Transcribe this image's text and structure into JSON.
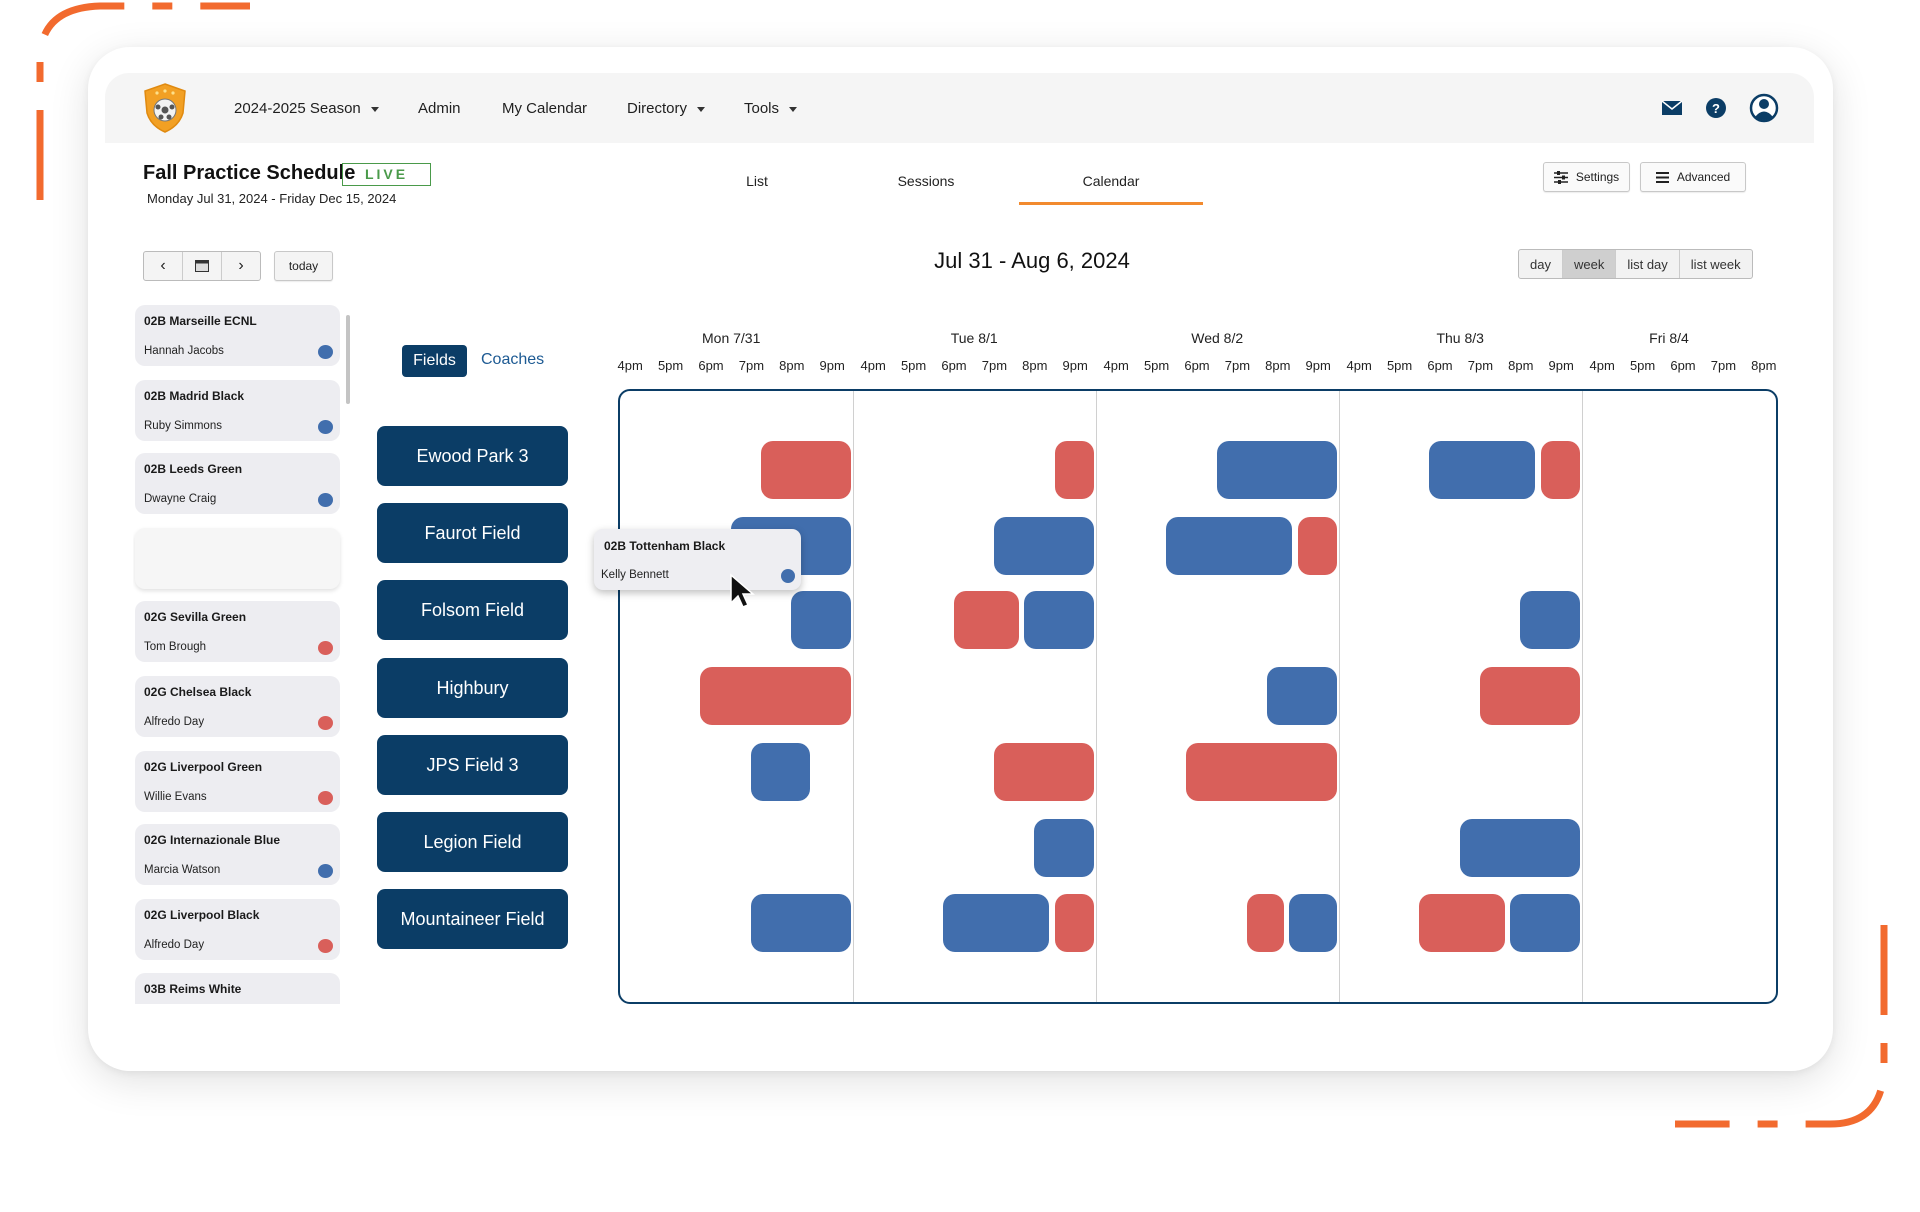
{
  "colors": {
    "navy": "#0b3d66",
    "blue": "#416ead",
    "red": "#d95f5a",
    "accent": "#f28a2e",
    "live": "#4a9a4a",
    "decoration": "#f26a2e"
  },
  "header": {
    "logo": "shield-soccer-ball-logo",
    "nav": [
      {
        "label": "2024-2025 Season",
        "dropdown": true
      },
      {
        "label": "Admin",
        "dropdown": false
      },
      {
        "label": "My Calendar",
        "dropdown": false
      },
      {
        "label": "Directory",
        "dropdown": true
      },
      {
        "label": "Tools",
        "dropdown": true
      }
    ],
    "icons": [
      "mail-icon",
      "help-icon",
      "user-account-icon"
    ]
  },
  "schedule": {
    "title": "Fall Practice Schedule",
    "status": "LIVE",
    "date_range": "Monday Jul 31, 2024 - Friday Dec 15, 2024"
  },
  "tabs": [
    {
      "label": "List",
      "active": false
    },
    {
      "label": "Sessions",
      "active": false
    },
    {
      "label": "Calendar",
      "active": true
    }
  ],
  "toolbar": {
    "settings_label": "Settings",
    "advanced_label": "Advanced",
    "today_label": "today"
  },
  "calendar": {
    "range_title": "Jul 31 - Aug 6, 2024",
    "views": [
      {
        "label": "day",
        "active": false
      },
      {
        "label": "week",
        "active": true
      },
      {
        "label": "list day",
        "active": false
      },
      {
        "label": "list week",
        "active": false
      }
    ],
    "days": [
      {
        "label": "Mon 7/31",
        "hours": [
          "4pm",
          "5pm",
          "6pm",
          "7pm",
          "8pm",
          "9pm"
        ]
      },
      {
        "label": "Tue 8/1",
        "hours": [
          "4pm",
          "5pm",
          "6pm",
          "7pm",
          "8pm",
          "9pm"
        ]
      },
      {
        "label": "Wed 8/2",
        "hours": [
          "4pm",
          "5pm",
          "6pm",
          "7pm",
          "8pm",
          "9pm"
        ]
      },
      {
        "label": "Thu 8/3",
        "hours": [
          "4pm",
          "5pm",
          "6pm",
          "7pm",
          "8pm",
          "9pm"
        ]
      },
      {
        "label": "Fri 8/4",
        "hours": [
          "4pm",
          "5pm",
          "6pm",
          "7pm",
          "8pm"
        ]
      }
    ],
    "events": [
      {
        "field": 0,
        "day": 0,
        "start": 19.75,
        "end": 22,
        "color": "red"
      },
      {
        "field": 0,
        "day": 1,
        "start": 21,
        "end": 22,
        "color": "red"
      },
      {
        "field": 0,
        "day": 2,
        "start": 19,
        "end": 22,
        "color": "blue"
      },
      {
        "field": 0,
        "day": 3,
        "start": 18.25,
        "end": 20.9,
        "color": "blue"
      },
      {
        "field": 0,
        "day": 3,
        "start": 21,
        "end": 22,
        "color": "red"
      },
      {
        "field": 1,
        "day": 0,
        "start": 19,
        "end": 22,
        "color": "blue"
      },
      {
        "field": 1,
        "day": 1,
        "start": 19.5,
        "end": 22,
        "color": "blue"
      },
      {
        "field": 1,
        "day": 2,
        "start": 17.75,
        "end": 20.9,
        "color": "blue"
      },
      {
        "field": 1,
        "day": 2,
        "start": 21,
        "end": 22,
        "color": "red"
      },
      {
        "field": 2,
        "day": 0,
        "start": 20.5,
        "end": 22,
        "color": "blue"
      },
      {
        "field": 2,
        "day": 1,
        "start": 18.5,
        "end": 20.15,
        "color": "red"
      },
      {
        "field": 2,
        "day": 1,
        "start": 20.25,
        "end": 22,
        "color": "blue"
      },
      {
        "field": 2,
        "day": 3,
        "start": 20.5,
        "end": 22,
        "color": "blue"
      },
      {
        "field": 3,
        "day": 0,
        "start": 18.25,
        "end": 22,
        "color": "red"
      },
      {
        "field": 3,
        "day": 2,
        "start": 20.25,
        "end": 22,
        "color": "blue"
      },
      {
        "field": 3,
        "day": 3,
        "start": 19.5,
        "end": 22,
        "color": "red"
      },
      {
        "field": 4,
        "day": 0,
        "start": 19.5,
        "end": 21,
        "color": "blue"
      },
      {
        "field": 4,
        "day": 1,
        "start": 19.5,
        "end": 22,
        "color": "red"
      },
      {
        "field": 4,
        "day": 2,
        "start": 18.25,
        "end": 22,
        "color": "red"
      },
      {
        "field": 5,
        "day": 1,
        "start": 20.5,
        "end": 22,
        "color": "blue"
      },
      {
        "field": 5,
        "day": 3,
        "start": 19,
        "end": 22,
        "color": "blue"
      },
      {
        "field": 6,
        "day": 0,
        "start": 19.5,
        "end": 22,
        "color": "blue"
      },
      {
        "field": 6,
        "day": 1,
        "start": 18.25,
        "end": 20.9,
        "color": "blue"
      },
      {
        "field": 6,
        "day": 1,
        "start": 21,
        "end": 22,
        "color": "red"
      },
      {
        "field": 6,
        "day": 2,
        "start": 19.75,
        "end": 20.7,
        "color": "red"
      },
      {
        "field": 6,
        "day": 2,
        "start": 20.8,
        "end": 22,
        "color": "blue"
      },
      {
        "field": 6,
        "day": 3,
        "start": 18,
        "end": 20.15,
        "color": "red"
      },
      {
        "field": 6,
        "day": 3,
        "start": 20.25,
        "end": 22,
        "color": "blue"
      }
    ]
  },
  "resource_toggle": {
    "fields_label": "Fields",
    "coaches_label": "Coaches",
    "active": "Fields"
  },
  "fields": [
    "Ewood Park 3",
    "Faurot Field",
    "Folsom Field",
    "Highbury",
    "JPS Field 3",
    "Legion Field",
    "Mountaineer Field"
  ],
  "teams": [
    {
      "name": "02B Marseille ECNL",
      "coach": "Hannah Jacobs",
      "color": "blue"
    },
    {
      "name": "02B Madrid Black",
      "coach": "Ruby Simmons",
      "color": "blue"
    },
    {
      "name": "02B Leeds Green",
      "coach": "Dwayne Craig",
      "color": "blue"
    },
    {
      "name": "",
      "coach": "",
      "color": ""
    },
    {
      "name": "02G Sevilla Green",
      "coach": "Tom Brough",
      "color": "red"
    },
    {
      "name": "02G Chelsea Black",
      "coach": "Alfredo Day",
      "color": "red"
    },
    {
      "name": "02G Liverpool Green",
      "coach": "Willie Evans",
      "color": "red"
    },
    {
      "name": "02G Internazionale Blue",
      "coach": "Marcia Watson",
      "color": "blue"
    },
    {
      "name": "02G Liverpool Black",
      "coach": "Alfredo Day",
      "color": "red"
    },
    {
      "name": "03B Reims White",
      "coach": "",
      "color": ""
    }
  ],
  "dragging": {
    "name": "02B Tottenham Black",
    "coach": "Kelly Bennett",
    "color": "blue"
  }
}
